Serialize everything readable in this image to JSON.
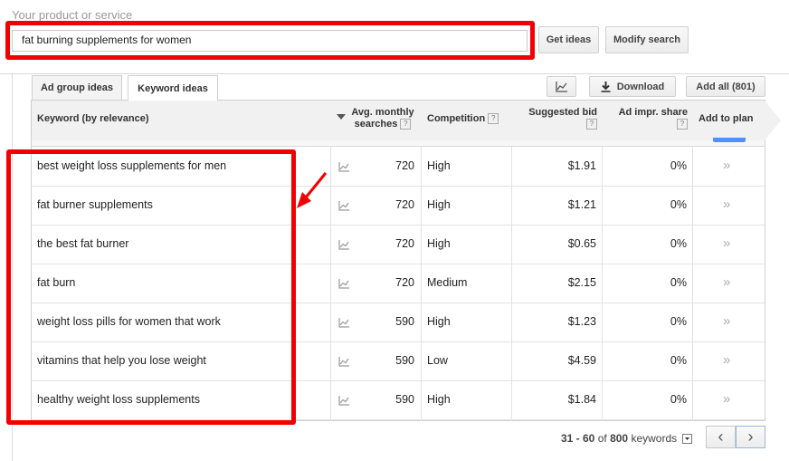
{
  "search": {
    "label": "Your product or service",
    "value": "fat burning supplements for women",
    "get_ideas": "Get ideas",
    "modify_search": "Modify search"
  },
  "tabs": [
    {
      "label": "Ad group ideas",
      "active": false
    },
    {
      "label": "Keyword ideas",
      "active": true
    }
  ],
  "toolbar": {
    "chart_icon": "line-chart-icon",
    "download_label": "Download",
    "download_icon": "download-icon",
    "add_all_label": "Add all (801)"
  },
  "columns": {
    "keyword": "Keyword (by relevance)",
    "searches_line1": "Avg. monthly",
    "searches_line2": "searches",
    "competition": "Competition",
    "bid": "Suggested bid",
    "impr_line1": "Ad impr. share",
    "add": "Add to plan",
    "help": "?"
  },
  "rows": [
    {
      "keyword": "best weight loss supplements for men",
      "searches": "720",
      "competition": "High",
      "bid": "$1.91",
      "impr": "0%"
    },
    {
      "keyword": "fat burner supplements",
      "searches": "720",
      "competition": "High",
      "bid": "$1.21",
      "impr": "0%"
    },
    {
      "keyword": "the best fat burner",
      "searches": "720",
      "competition": "High",
      "bid": "$0.65",
      "impr": "0%"
    },
    {
      "keyword": "fat burn",
      "searches": "720",
      "competition": "Medium",
      "bid": "$2.15",
      "impr": "0%"
    },
    {
      "keyword": "weight loss pills for women that work",
      "searches": "590",
      "competition": "High",
      "bid": "$1.23",
      "impr": "0%"
    },
    {
      "keyword": "vitamins that help you lose weight",
      "searches": "590",
      "competition": "Low",
      "bid": "$4.59",
      "impr": "0%"
    },
    {
      "keyword": "healthy weight loss supplements",
      "searches": "590",
      "competition": "High",
      "bid": "$1.84",
      "impr": "0%"
    }
  ],
  "add_glyph": "»",
  "pager": {
    "range": "31 - 60",
    "of": "of",
    "total": "800",
    "unit": "keywords",
    "prev": "‹",
    "next": "›"
  },
  "colors": {
    "highlight": "#f20000",
    "accent": "#4d90fe"
  }
}
